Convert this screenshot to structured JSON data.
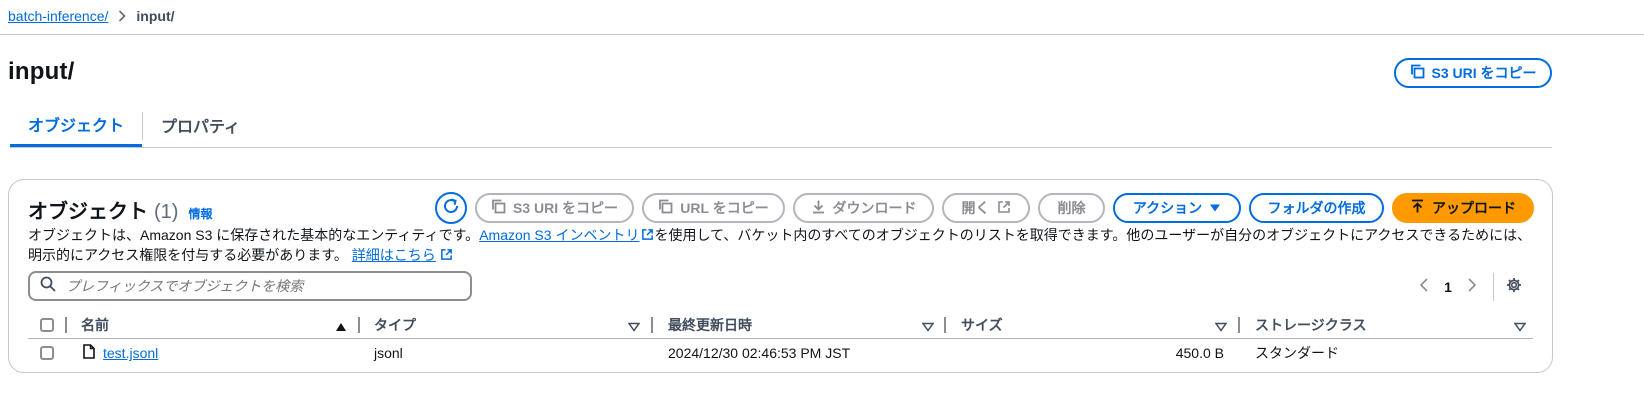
{
  "breadcrumb": {
    "parent": "batch-inference/",
    "current": "input/"
  },
  "page": {
    "title": "input/",
    "copy_uri_label": "S3 URI をコピー"
  },
  "tabs": [
    {
      "label": "オブジェクト",
      "active": true
    },
    {
      "label": "プロパティ",
      "active": false
    }
  ],
  "objects": {
    "title": "オブジェクト",
    "count": "(1)",
    "info_label": "情報",
    "actions": {
      "copy_s3_uri": "S3 URI をコピー",
      "copy_url": "URL をコピー",
      "download": "ダウンロード",
      "open": "開く",
      "delete": "削除",
      "actions": "アクション",
      "create_folder": "フォルダの作成",
      "upload": "アップロード"
    },
    "description": {
      "part1": "オブジェクトは、Amazon S3 に保存された基本的なエンティティです。",
      "inventory_link": "Amazon S3 インベントリ",
      "part2": "を使用して、バケット内のすべてのオブジェクトのリストを取得できます。他のユーザーが自分のオブジェクトにアクセスできるためには、明示的にアクセス権限を付与する必要があります。",
      "details_link": "詳細はこちら"
    },
    "search": {
      "placeholder": "プレフィックスでオブジェクトを検索"
    },
    "pagination": {
      "current_page": "1"
    },
    "columns": [
      "名前",
      "タイプ",
      "最終更新日時",
      "サイズ",
      "ストレージクラス"
    ],
    "rows": [
      {
        "name": "test.jsonl",
        "type": "jsonl",
        "modified": "2024/12/30 02:46:53 PM JST",
        "size": "450.0 B",
        "storage_class": "スタンダード"
      }
    ]
  },
  "colors": {
    "link": "#006ce0",
    "primary": "#ff9900",
    "disabled": "#8c8c94"
  }
}
